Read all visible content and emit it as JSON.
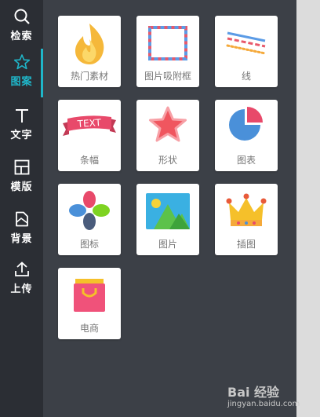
{
  "sidebar": {
    "items": [
      {
        "label": "检索",
        "icon": "search-icon",
        "active": false
      },
      {
        "label": "图案",
        "icon": "star-icon",
        "active": true
      },
      {
        "label": "文字",
        "icon": "text-icon",
        "active": false
      },
      {
        "label": "模版",
        "icon": "layout-icon",
        "active": false
      },
      {
        "label": "背景",
        "icon": "background-icon",
        "active": false
      },
      {
        "label": "上传",
        "icon": "upload-icon",
        "active": false
      }
    ],
    "accent_color": "#1fb6c9"
  },
  "categories": [
    {
      "label": "热门素材",
      "icon": "flame-icon"
    },
    {
      "label": "图片吸附框",
      "icon": "envelope-frame-icon"
    },
    {
      "label": "线",
      "icon": "lines-icon"
    },
    {
      "label": "条幅",
      "icon": "banner-icon"
    },
    {
      "label": "形状",
      "icon": "star-shape-icon"
    },
    {
      "label": "图表",
      "icon": "pie-chart-icon"
    },
    {
      "label": "图标",
      "icon": "petals-icon"
    },
    {
      "label": "图片",
      "icon": "picture-icon"
    },
    {
      "label": "插图",
      "icon": "crown-icon"
    },
    {
      "label": "电商",
      "icon": "shopping-bag-icon"
    }
  ],
  "banner_text": "TEXT",
  "watermark": {
    "line1": "Bai 经验",
    "line2": "jingyan.baidu.com"
  }
}
